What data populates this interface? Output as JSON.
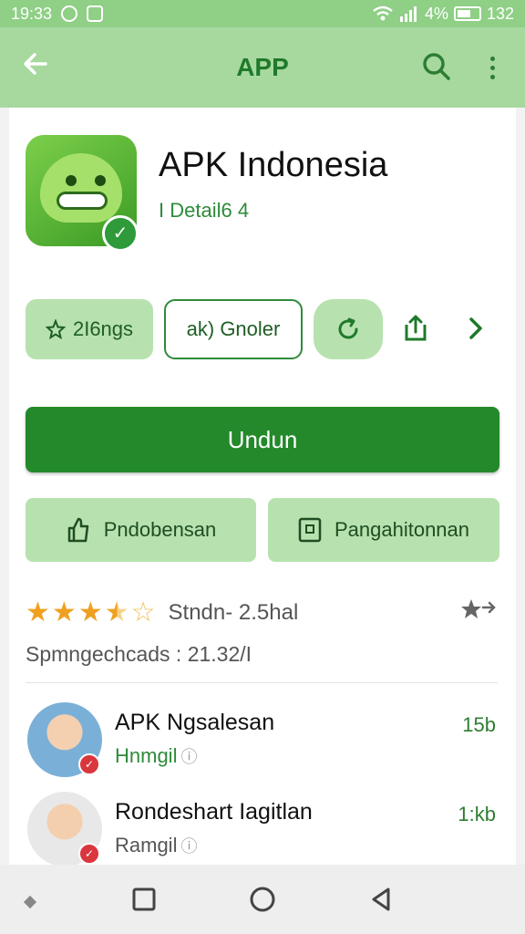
{
  "status_bar": {
    "time": "19:33",
    "battery": "4%",
    "extra": "132"
  },
  "app_bar": {
    "title": "APP"
  },
  "app": {
    "name": "APK Indonesia",
    "subtitle": "I Detail6 4"
  },
  "chips": [
    {
      "label": "2I6ngs"
    },
    {
      "label": "ak) Gnolеr"
    }
  ],
  "download": {
    "label": "Undun"
  },
  "secondary_buttons": [
    {
      "label": "Pndobensan"
    },
    {
      "label": "Pangahitonnan"
    }
  ],
  "rating": {
    "value": 3.5,
    "text": "Stndn- 2.5hal"
  },
  "downloads_text": "Spmngechcads : 21.32/I",
  "reviews": [
    {
      "name": "APK Ngsalesan",
      "sub": "Hnmgil",
      "size": "15b"
    },
    {
      "name": "Rondeshart Iagitlan",
      "sub": "Ramgil",
      "size": "1:kb"
    }
  ],
  "colors": {
    "primary": "#23892a",
    "app_bar": "#a7d99f",
    "chip": "#b7e2af",
    "star": "#f0a020"
  }
}
